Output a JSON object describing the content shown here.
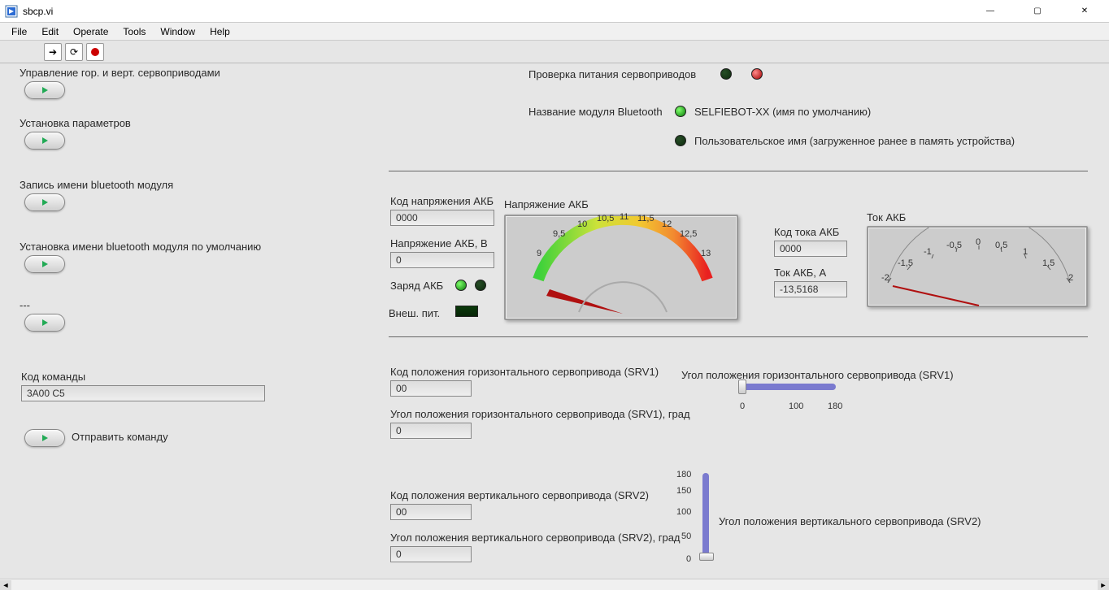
{
  "window": {
    "title": "sbcp.vi"
  },
  "menu": {
    "file": "File",
    "edit": "Edit",
    "operate": "Operate",
    "tools": "Tools",
    "window": "Window",
    "help": "Help"
  },
  "left": {
    "ctrl_servos": "Управление гор. и верт. сервоприводами",
    "set_params": "Установка параметров",
    "write_bt_name": "Запись имени bluetooth модуля",
    "set_bt_default": "Установка имени bluetooth модуля по умолчанию",
    "dash": "---",
    "cmd_code_label": "Код команды",
    "cmd_code_value": "3A00 C5",
    "send_cmd": "Отправить команду"
  },
  "right": {
    "check_power": "Проверка питания сервоприводов",
    "bt_module_name_label": "Название модуля Bluetooth",
    "bt_default_name": "SELFIEBOT-XX (имя по умолчанию)",
    "bt_user_name": "Пользовательское имя (загруженное ранее в память устройства)",
    "voltage_code_label": "Код напряжения АКБ",
    "voltage_code_value": "0000",
    "voltage_label": "Напряжение АКБ, В",
    "voltage_value": "0",
    "charge_label": "Заряд АКБ",
    "ext_power_label": "Внеш. пит.",
    "gauge_voltage_title": "Напряжение АКБ",
    "gauge_current_title": "Ток АКБ",
    "current_code_label": "Код тока АКБ",
    "current_code_value": "0000",
    "current_label": "Ток АКБ, А",
    "current_value": "-13,5168",
    "srv1_code_label": "Код положения горизонтального сервопривода (SRV1)",
    "srv1_code_value": "00",
    "srv1_angle_label": "Угол положения горизонтального сервопривода (SRV1), град",
    "srv1_angle_value": "0",
    "srv1_slider_title": "Угол положения горизонтального сервопривода (SRV1)",
    "srv2_code_label": "Код положения вертикального сервопривода (SRV2)",
    "srv2_code_value": "00",
    "srv2_angle_label": "Угол положения вертикального сервопривода (SRV2), град",
    "srv2_angle_value": "0",
    "srv2_slider_title": "Угол положения вертикального сервопривода (SRV2)"
  },
  "gauge": {
    "voltage_ticks": [
      "9",
      "9,5",
      "10",
      "10,5",
      "11",
      "11,5",
      "12",
      "12,5",
      "13"
    ],
    "current_ticks": [
      "-2",
      "-1,5",
      "-1",
      "-0,5",
      "0",
      "0,5",
      "1",
      "1,5",
      "2"
    ]
  },
  "slider_h": {
    "t0": "0",
    "t100": "100",
    "t180": "180"
  },
  "slider_v": {
    "t0": "0",
    "t50": "50",
    "t100": "100",
    "t150": "150",
    "t180": "180"
  }
}
